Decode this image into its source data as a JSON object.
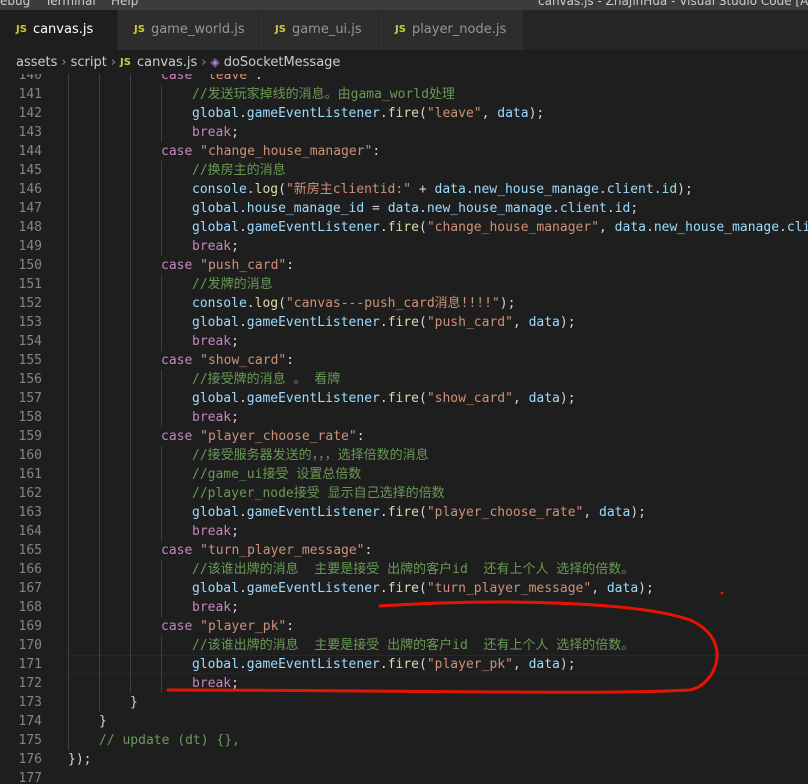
{
  "window": {
    "menu": [
      "ebug",
      "Terminal",
      "Help"
    ],
    "title": "canvas.js - ZhaJinHua - Visual Studio Code [Administrator]"
  },
  "tabs": [
    {
      "label": "canvas.js",
      "active": true,
      "icon": "JS"
    },
    {
      "label": "game_world.js",
      "active": false,
      "icon": "JS"
    },
    {
      "label": "game_ui.js",
      "active": false,
      "icon": "JS"
    },
    {
      "label": "player_node.js",
      "active": false,
      "icon": "JS"
    }
  ],
  "breadcrumb": [
    "assets",
    "script",
    "canvas.js",
    "doSocketMessage"
  ],
  "colors": {
    "keyword": "#569cd6",
    "string": "#ce9178",
    "comment": "#6a9955",
    "variable": "#9cdcfe",
    "function": "#dcdcaa",
    "control": "#c586c0",
    "annotation": "#e51400"
  },
  "lines": [
    {
      "n": "140",
      "indent": 3,
      "tokens": [
        [
          "ctl",
          "case "
        ],
        [
          "str",
          "\"leave\""
        ],
        [
          "pl",
          ":"
        ]
      ]
    },
    {
      "n": "141",
      "indent": 4,
      "tokens": [
        [
          "cm",
          "//发送玩家掉线的消息。由gama_world处理"
        ]
      ]
    },
    {
      "n": "142",
      "indent": 4,
      "tokens": [
        [
          "var",
          "global"
        ],
        [
          "pl",
          "."
        ],
        [
          "var",
          "gameEventListener"
        ],
        [
          "pl",
          "."
        ],
        [
          "fn",
          "fire"
        ],
        [
          "pl",
          "("
        ],
        [
          "str",
          "\"leave\""
        ],
        [
          "pl",
          ", "
        ],
        [
          "var",
          "data"
        ],
        [
          "pl",
          ");"
        ]
      ]
    },
    {
      "n": "143",
      "indent": 4,
      "tokens": [
        [
          "ctl",
          "break"
        ],
        [
          "pl",
          ";"
        ]
      ]
    },
    {
      "n": "144",
      "indent": 3,
      "tokens": [
        [
          "ctl",
          "case "
        ],
        [
          "str",
          "\"change_house_manager\""
        ],
        [
          "pl",
          ":"
        ]
      ]
    },
    {
      "n": "145",
      "indent": 4,
      "tokens": [
        [
          "cm",
          "//换房主的消息"
        ]
      ]
    },
    {
      "n": "146",
      "indent": 4,
      "tokens": [
        [
          "var",
          "console"
        ],
        [
          "pl",
          "."
        ],
        [
          "fn",
          "log"
        ],
        [
          "pl",
          "("
        ],
        [
          "str",
          "\"新房主clientid:\""
        ],
        [
          "pl",
          " + "
        ],
        [
          "var",
          "data"
        ],
        [
          "pl",
          "."
        ],
        [
          "var",
          "new_house_manage"
        ],
        [
          "pl",
          "."
        ],
        [
          "var",
          "client"
        ],
        [
          "pl",
          "."
        ],
        [
          "var",
          "id"
        ],
        [
          "pl",
          ");"
        ]
      ]
    },
    {
      "n": "147",
      "indent": 4,
      "tokens": [
        [
          "var",
          "global"
        ],
        [
          "pl",
          "."
        ],
        [
          "var",
          "house_manage_id"
        ],
        [
          "pl",
          " = "
        ],
        [
          "var",
          "data"
        ],
        [
          "pl",
          "."
        ],
        [
          "var",
          "new_house_manage"
        ],
        [
          "pl",
          "."
        ],
        [
          "var",
          "client"
        ],
        [
          "pl",
          "."
        ],
        [
          "var",
          "id"
        ],
        [
          "pl",
          ";"
        ]
      ]
    },
    {
      "n": "148",
      "indent": 4,
      "tokens": [
        [
          "var",
          "global"
        ],
        [
          "pl",
          "."
        ],
        [
          "var",
          "gameEventListener"
        ],
        [
          "pl",
          "."
        ],
        [
          "fn",
          "fire"
        ],
        [
          "pl",
          "("
        ],
        [
          "str",
          "\"change_house_manager\""
        ],
        [
          "pl",
          ", "
        ],
        [
          "var",
          "data"
        ],
        [
          "pl",
          "."
        ],
        [
          "var",
          "new_house_manage"
        ],
        [
          "pl",
          "."
        ],
        [
          "var",
          "client"
        ],
        [
          "pl",
          "."
        ],
        [
          "var",
          "id"
        ],
        [
          "pl",
          ");"
        ]
      ]
    },
    {
      "n": "149",
      "indent": 4,
      "tokens": [
        [
          "ctl",
          "break"
        ],
        [
          "pl",
          ";"
        ]
      ]
    },
    {
      "n": "150",
      "indent": 3,
      "tokens": [
        [
          "ctl",
          "case "
        ],
        [
          "str",
          "\"push_card\""
        ],
        [
          "pl",
          ":"
        ]
      ]
    },
    {
      "n": "151",
      "indent": 4,
      "tokens": [
        [
          "cm",
          "//发牌的消息"
        ]
      ]
    },
    {
      "n": "152",
      "indent": 4,
      "tokens": [
        [
          "var",
          "console"
        ],
        [
          "pl",
          "."
        ],
        [
          "fn",
          "log"
        ],
        [
          "pl",
          "("
        ],
        [
          "str",
          "\"canvas---push_card消息!!!!\""
        ],
        [
          "pl",
          ");"
        ]
      ]
    },
    {
      "n": "153",
      "indent": 4,
      "tokens": [
        [
          "var",
          "global"
        ],
        [
          "pl",
          "."
        ],
        [
          "var",
          "gameEventListener"
        ],
        [
          "pl",
          "."
        ],
        [
          "fn",
          "fire"
        ],
        [
          "pl",
          "("
        ],
        [
          "str",
          "\"push_card\""
        ],
        [
          "pl",
          ", "
        ],
        [
          "var",
          "data"
        ],
        [
          "pl",
          ");"
        ]
      ]
    },
    {
      "n": "154",
      "indent": 4,
      "tokens": [
        [
          "ctl",
          "break"
        ],
        [
          "pl",
          ";"
        ]
      ]
    },
    {
      "n": "155",
      "indent": 3,
      "tokens": [
        [
          "ctl",
          "case "
        ],
        [
          "str",
          "\"show_card\""
        ],
        [
          "pl",
          ":"
        ]
      ]
    },
    {
      "n": "156",
      "indent": 4,
      "tokens": [
        [
          "cm",
          "//接受牌的消息 。 看牌"
        ]
      ]
    },
    {
      "n": "157",
      "indent": 4,
      "tokens": [
        [
          "var",
          "global"
        ],
        [
          "pl",
          "."
        ],
        [
          "var",
          "gameEventListener"
        ],
        [
          "pl",
          "."
        ],
        [
          "fn",
          "fire"
        ],
        [
          "pl",
          "("
        ],
        [
          "str",
          "\"show_card\""
        ],
        [
          "pl",
          ", "
        ],
        [
          "var",
          "data"
        ],
        [
          "pl",
          ");"
        ]
      ]
    },
    {
      "n": "158",
      "indent": 4,
      "tokens": [
        [
          "ctl",
          "break"
        ],
        [
          "pl",
          ";"
        ]
      ]
    },
    {
      "n": "159",
      "indent": 3,
      "tokens": [
        [
          "ctl",
          "case "
        ],
        [
          "str",
          "\"player_choose_rate\""
        ],
        [
          "pl",
          ":"
        ]
      ]
    },
    {
      "n": "160",
      "indent": 4,
      "tokens": [
        [
          "cm",
          "//接受服务器发送的，，，选择倍数的消息"
        ]
      ]
    },
    {
      "n": "161",
      "indent": 4,
      "tokens": [
        [
          "cm",
          "//game_ui接受 设置总倍数"
        ]
      ]
    },
    {
      "n": "162",
      "indent": 4,
      "tokens": [
        [
          "cm",
          "//player_node接受 显示自己选择的倍数"
        ]
      ]
    },
    {
      "n": "163",
      "indent": 4,
      "tokens": [
        [
          "var",
          "global"
        ],
        [
          "pl",
          "."
        ],
        [
          "var",
          "gameEventListener"
        ],
        [
          "pl",
          "."
        ],
        [
          "fn",
          "fire"
        ],
        [
          "pl",
          "("
        ],
        [
          "str",
          "\"player_choose_rate\""
        ],
        [
          "pl",
          ", "
        ],
        [
          "var",
          "data"
        ],
        [
          "pl",
          ");"
        ]
      ]
    },
    {
      "n": "164",
      "indent": 4,
      "tokens": [
        [
          "ctl",
          "break"
        ],
        [
          "pl",
          ";"
        ]
      ]
    },
    {
      "n": "165",
      "indent": 3,
      "tokens": [
        [
          "ctl",
          "case "
        ],
        [
          "str",
          "\"turn_player_message\""
        ],
        [
          "pl",
          ":"
        ]
      ]
    },
    {
      "n": "166",
      "indent": 4,
      "tokens": [
        [
          "cm",
          "//该谁出牌的消息  主要是接受 出牌的客户id  还有上个人 选择的倍数。"
        ]
      ]
    },
    {
      "n": "167",
      "indent": 4,
      "tokens": [
        [
          "var",
          "global"
        ],
        [
          "pl",
          "."
        ],
        [
          "var",
          "gameEventListener"
        ],
        [
          "pl",
          "."
        ],
        [
          "fn",
          "fire"
        ],
        [
          "pl",
          "("
        ],
        [
          "str",
          "\"turn_player_message\""
        ],
        [
          "pl",
          ", "
        ],
        [
          "var",
          "data"
        ],
        [
          "pl",
          ");"
        ]
      ]
    },
    {
      "n": "168",
      "indent": 4,
      "tokens": [
        [
          "ctl",
          "break"
        ],
        [
          "pl",
          ";"
        ]
      ]
    },
    {
      "n": "169",
      "indent": 3,
      "tokens": [
        [
          "ctl",
          "case "
        ],
        [
          "str",
          "\"player_pk\""
        ],
        [
          "pl",
          ":"
        ]
      ]
    },
    {
      "n": "170",
      "indent": 4,
      "tokens": [
        [
          "cm",
          "//该谁出牌的消息  主要是接受 出牌的客户id  还有上个人 选择的倍数。"
        ]
      ]
    },
    {
      "n": "171",
      "indent": 4,
      "tokens": [
        [
          "var",
          "global"
        ],
        [
          "pl",
          "."
        ],
        [
          "var",
          "gameEventListener"
        ],
        [
          "pl",
          "."
        ],
        [
          "fn",
          "fire"
        ],
        [
          "pl",
          "("
        ],
        [
          "str",
          "\"player_pk\""
        ],
        [
          "pl",
          ", "
        ],
        [
          "var",
          "data"
        ],
        [
          "pl",
          ");"
        ]
      ]
    },
    {
      "n": "172",
      "indent": 4,
      "tokens": [
        [
          "ctl",
          "break"
        ],
        [
          "pl",
          ";"
        ]
      ]
    },
    {
      "n": "173",
      "indent": 2,
      "tokens": [
        [
          "pl",
          "}"
        ]
      ]
    },
    {
      "n": "174",
      "indent": 1,
      "tokens": [
        [
          "pl",
          "}"
        ]
      ]
    },
    {
      "n": "175",
      "indent": 1,
      "tokens": [
        [
          "cm",
          "// update (dt) {},"
        ]
      ]
    },
    {
      "n": "176",
      "indent": 0,
      "tokens": [
        [
          "pl",
          "});"
        ]
      ]
    },
    {
      "n": "177",
      "indent": 0,
      "tokens": []
    }
  ]
}
